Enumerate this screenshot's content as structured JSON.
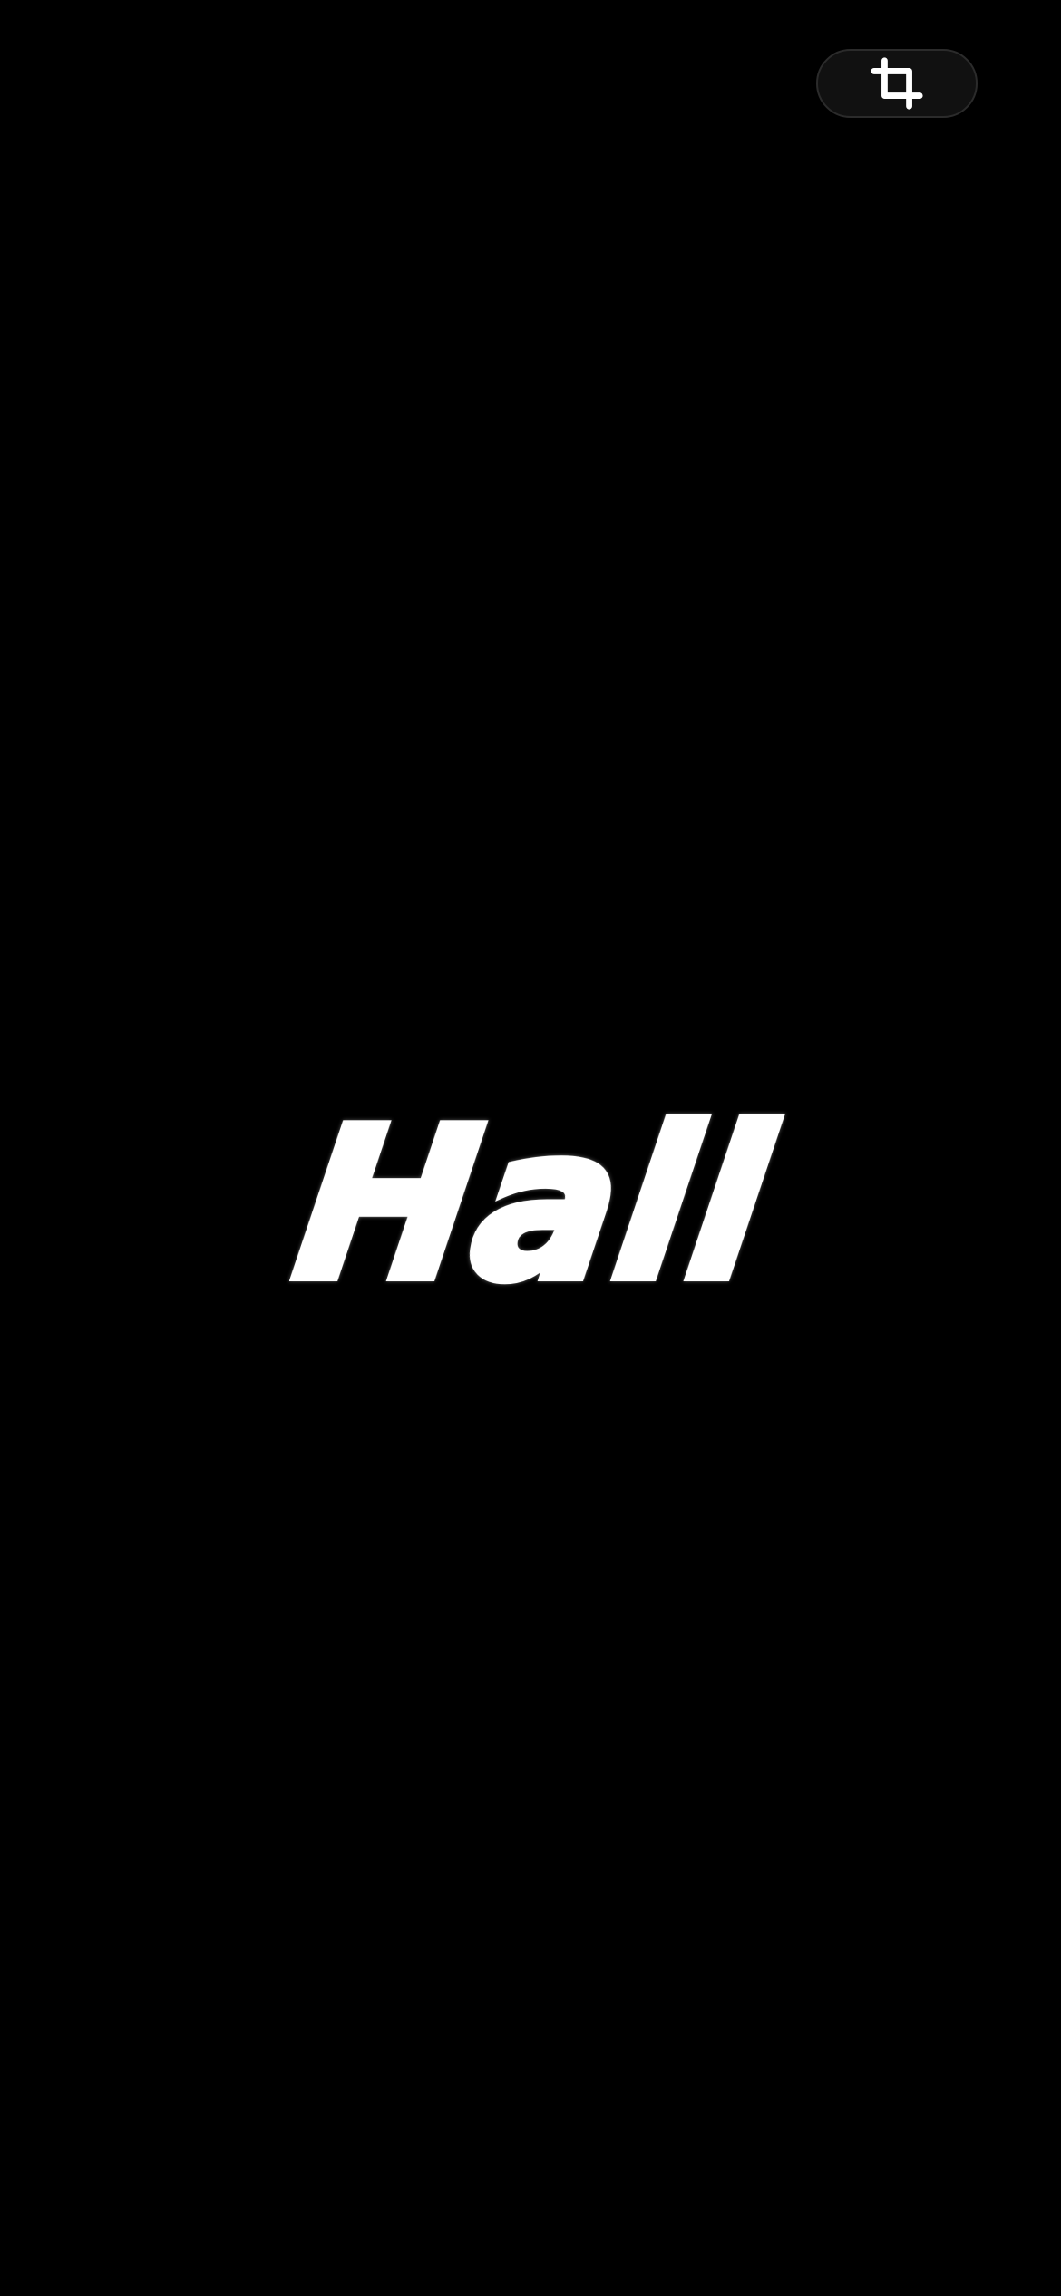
{
  "toolbar": {
    "crop_icon": "crop-icon"
  },
  "content": {
    "title": "Hall"
  },
  "colors": {
    "background": "#000000",
    "text": "#ffffff",
    "button_background": "#111111",
    "button_border": "#2b2b2b"
  }
}
